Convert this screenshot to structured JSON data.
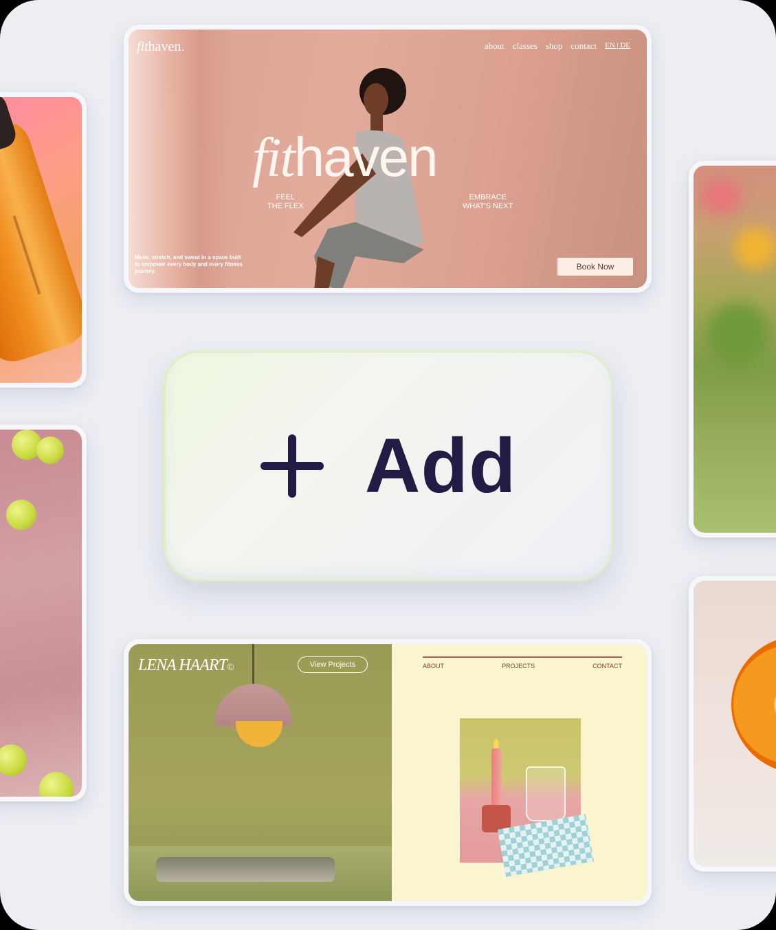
{
  "fithaven": {
    "logo_prefix": "fit",
    "logo_suffix": "haven.",
    "nav": [
      "about",
      "classes",
      "shop",
      "contact"
    ],
    "lang": "EN | DE",
    "hero_fit": "fit",
    "hero_haven": "haven",
    "tag1_line1": "FEEL",
    "tag1_line2": "THE FLEX",
    "tag2_line1": "EMBRACE",
    "tag2_line2": "WHAT'S NEXT",
    "tagline": "Move, stretch, and sweat in a space built to empower every body and every fitness journey.",
    "book_label": "Book Now"
  },
  "add_card": {
    "label": "Add",
    "icon": "plus-icon"
  },
  "lena": {
    "logo": "LENA HAART",
    "logo_mark": "©",
    "view_projects": "View Projects",
    "nav": [
      "ABOUT",
      "PROJECTS",
      "CONTACT"
    ]
  },
  "colors": {
    "canvas": "#eceef3",
    "add_text": "#241b44",
    "fithaven_bg": "#e2ab9b",
    "lena_bg": "#fbf5cf"
  }
}
